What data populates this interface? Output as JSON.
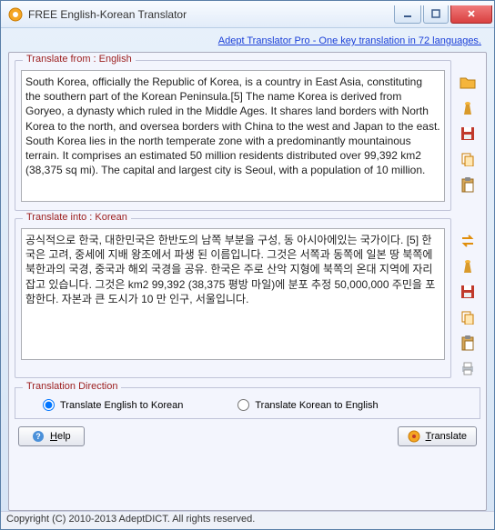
{
  "window": {
    "title": "FREE English-Korean Translator"
  },
  "toplink": {
    "text": "Adept Translator Pro - One key translation in 72 languages."
  },
  "source": {
    "label": "Translate from : English",
    "text": "South Korea, officially the Republic of Korea, is a country in East Asia, constituting the southern part of the Korean Peninsula.[5] The name Korea is derived from Goryeo, a dynasty which ruled in the Middle Ages. It shares land borders with North Korea to the north, and oversea borders with China to the west and Japan to the east. South Korea lies in the north temperate zone with a predominantly mountainous terrain. It comprises an estimated 50 million residents distributed over 99,392 km2 (38,375 sq mi). The capital and largest city is Seoul, with a population of 10 million."
  },
  "target": {
    "label": "Translate into : Korean",
    "text": "공식적으로 한국, 대한민국은 한반도의 남쪽 부분을 구성, 동 아시아에있는 국가이다. [5] 한국은 고려, 중세에 지배 왕조에서 파생 된 이름입니다. 그것은 서쪽과 동쪽에 일본 땅 북쪽에 북한과의 국경, 중국과 해외 국경을 공유. 한국은 주로 산악 지형에 북쪽의 온대 지역에 자리 잡고 있습니다. 그것은 km2 99,392 (38,375 평방 마일)에 분포 추정 50,000,000 주민을 포함한다. 자본과 큰 도시가 10 만 인구, 서울입니다."
  },
  "direction": {
    "label": "Translation Direction",
    "opt1": "Translate English to Korean",
    "opt2": "Translate Korean to English",
    "selected": "opt1"
  },
  "buttons": {
    "help": "Help",
    "translate": "Translate"
  },
  "status": "Copyright (C) 2010-2013 AdeptDICT. All rights reserved."
}
